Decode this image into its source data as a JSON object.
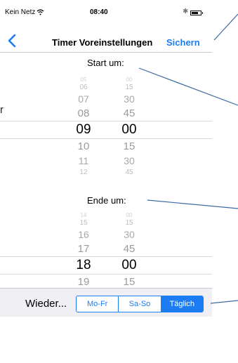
{
  "status": {
    "carrier": "Kein Netz",
    "time": "08:40"
  },
  "nav": {
    "title": "Timer Voreinstellungen",
    "save_label": "Sichern"
  },
  "start": {
    "label": "Start um:",
    "rows": [
      {
        "h": "05",
        "m": "00"
      },
      {
        "h": "06",
        "m": "15"
      },
      {
        "h": "07",
        "m": "30"
      },
      {
        "h": "08",
        "m": "45"
      },
      {
        "h": "09",
        "m": "00"
      },
      {
        "h": "10",
        "m": "15"
      },
      {
        "h": "11",
        "m": "30"
      },
      {
        "h": "12",
        "m": "45"
      }
    ]
  },
  "end": {
    "label": "Ende um:",
    "rows": [
      {
        "h": "14",
        "m": "00"
      },
      {
        "h": "15",
        "m": "15"
      },
      {
        "h": "16",
        "m": "30"
      },
      {
        "h": "17",
        "m": "45"
      },
      {
        "h": "18",
        "m": "00"
      },
      {
        "h": "19",
        "m": "15"
      }
    ]
  },
  "repeat": {
    "label": "Wieder...",
    "options": [
      "Mo-Fr",
      "Sa-So",
      "Täglich"
    ],
    "selected": "Täglich"
  },
  "side_text": "r",
  "colors": {
    "accent": "#1b7cf3",
    "callout": "#3b6aa0"
  }
}
